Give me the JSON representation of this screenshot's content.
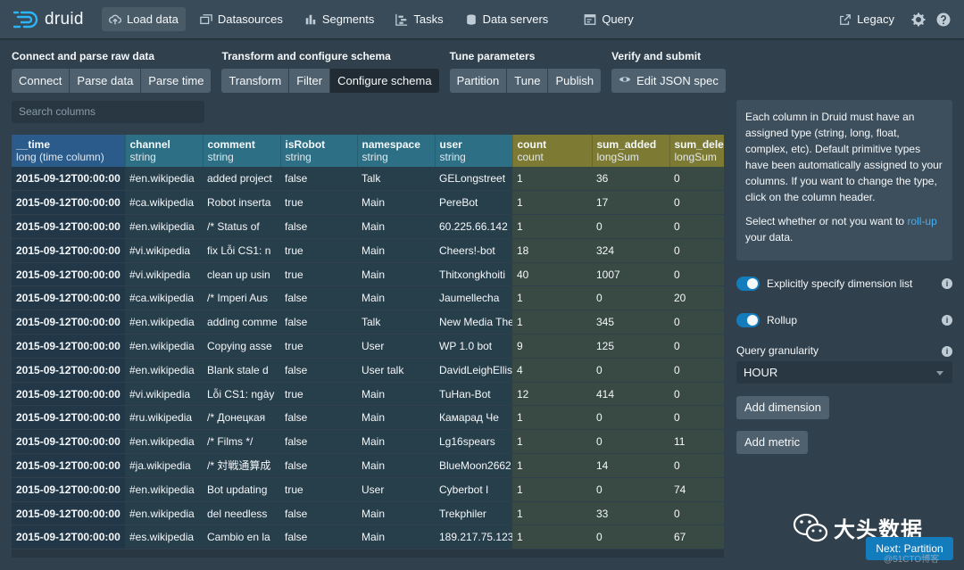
{
  "app": {
    "name": "druid"
  },
  "nav": {
    "items": [
      {
        "label": "Load data",
        "icon": "cloud-upload-icon",
        "active": true
      },
      {
        "label": "Datasources",
        "icon": "multi-select-icon",
        "active": false
      },
      {
        "label": "Segments",
        "icon": "stacked-chart-icon",
        "active": false
      },
      {
        "label": "Tasks",
        "icon": "gantt-chart-icon",
        "active": false
      },
      {
        "label": "Data servers",
        "icon": "database-icon",
        "active": false
      },
      {
        "label": "Query",
        "icon": "application-icon",
        "active": false
      }
    ],
    "legacy": "Legacy"
  },
  "steps": [
    {
      "title": "Connect and parse raw data",
      "buttons": [
        "Connect",
        "Parse data",
        "Parse time"
      ]
    },
    {
      "title": "Transform and configure schema",
      "buttons": [
        "Transform",
        "Filter",
        "Configure schema"
      ]
    },
    {
      "title": "Tune parameters",
      "buttons": [
        "Partition",
        "Tune",
        "Publish"
      ]
    },
    {
      "title": "Verify and submit",
      "buttons": [
        "Edit JSON spec"
      ]
    }
  ],
  "active_step": "Configure schema",
  "search": {
    "placeholder": "Search columns"
  },
  "table": {
    "columns": [
      {
        "name": "__time",
        "type": "long (time column)",
        "kind": "time"
      },
      {
        "name": "channel",
        "type": "string",
        "kind": "dim"
      },
      {
        "name": "comment",
        "type": "string",
        "kind": "dim"
      },
      {
        "name": "isRobot",
        "type": "string",
        "kind": "dim"
      },
      {
        "name": "namespace",
        "type": "string",
        "kind": "dim"
      },
      {
        "name": "user",
        "type": "string",
        "kind": "dim"
      },
      {
        "name": "count",
        "type": "count",
        "kind": "met"
      },
      {
        "name": "sum_added",
        "type": "longSum",
        "kind": "met"
      },
      {
        "name": "sum_deleted",
        "type": "longSum",
        "kind": "met"
      }
    ],
    "rows": [
      [
        "2015-09-12T00:00:00",
        "#en.wikipedia",
        "added project",
        "false",
        "Talk",
        "GELongstreet",
        "1",
        "36",
        "0"
      ],
      [
        "2015-09-12T00:00:00",
        "#ca.wikipedia",
        "Robot inserta",
        "true",
        "Main",
        "PereBot",
        "1",
        "17",
        "0"
      ],
      [
        "2015-09-12T00:00:00",
        "#en.wikipedia",
        "/* Status of ",
        "false",
        "Main",
        "60.225.66.142",
        "1",
        "0",
        "0"
      ],
      [
        "2015-09-12T00:00:00",
        "#vi.wikipedia",
        "fix Lỗi CS1: n",
        "true",
        "Main",
        "Cheers!-bot",
        "18",
        "324",
        "0"
      ],
      [
        "2015-09-12T00:00:00",
        "#vi.wikipedia",
        "clean up usin",
        "true",
        "Main",
        "Thitxongkhoiti",
        "40",
        "1007",
        "0"
      ],
      [
        "2015-09-12T00:00:00",
        "#ca.wikipedia",
        "/* Imperi Aus",
        "false",
        "Main",
        "Jaumellecha",
        "1",
        "0",
        "20"
      ],
      [
        "2015-09-12T00:00:00",
        "#en.wikipedia",
        "adding comme",
        "false",
        "Talk",
        "New Media The",
        "1",
        "345",
        "0"
      ],
      [
        "2015-09-12T00:00:00",
        "#en.wikipedia",
        "Copying asse",
        "true",
        "User",
        "WP 1.0 bot",
        "9",
        "125",
        "0"
      ],
      [
        "2015-09-12T00:00:00",
        "#en.wikipedia",
        "Blank stale d",
        "false",
        "User talk",
        "DavidLeighEllis",
        "4",
        "0",
        "0"
      ],
      [
        "2015-09-12T00:00:00",
        "#vi.wikipedia",
        "Lỗi CS1: ngày",
        "true",
        "Main",
        "TuHan-Bot",
        "12",
        "414",
        "0"
      ],
      [
        "2015-09-12T00:00:00",
        "#ru.wikipedia",
        "/* Донецкая ",
        "false",
        "Main",
        "Камарад Че",
        "1",
        "0",
        "0"
      ],
      [
        "2015-09-12T00:00:00",
        "#en.wikipedia",
        "/* Films */",
        "false",
        "Main",
        "Lg16spears",
        "1",
        "0",
        "11"
      ],
      [
        "2015-09-12T00:00:00",
        "#ja.wikipedia",
        "/* 対戦通算成",
        "false",
        "Main",
        "BlueMoon2662",
        "1",
        "14",
        "0"
      ],
      [
        "2015-09-12T00:00:00",
        "#en.wikipedia",
        "Bot updating ",
        "true",
        "User",
        "Cyberbot I",
        "1",
        "0",
        "74"
      ],
      [
        "2015-09-12T00:00:00",
        "#en.wikipedia",
        "del needless ",
        "false",
        "Main",
        "Trekphiler",
        "1",
        "33",
        "0"
      ],
      [
        "2015-09-12T00:00:00",
        "#es.wikipedia",
        "Cambio en la ",
        "false",
        "Main",
        "189.217.75.123",
        "1",
        "0",
        "67"
      ]
    ]
  },
  "panel": {
    "callout_p1": "Each column in Druid must have an assigned type (string, long, float, complex, etc). Default primitive types have been automatically assigned to your columns. If you want to change the type, click on the column header.",
    "callout_p2_before": "Select whether or not you want to ",
    "callout_p2_link": "roll-up",
    "callout_p2_after": " your data.",
    "explicit_dims_label": "Explicitly specify dimension list",
    "rollup_label": "Rollup",
    "granularity_label": "Query granularity",
    "granularity_value": "HOUR",
    "add_dimension": "Add dimension",
    "add_metric": "Add metric"
  },
  "next_button": "Next: Partition",
  "watermark": {
    "text": "大头数据"
  },
  "credit": "@51CTO博客",
  "colors": {
    "accent": "#137cbd",
    "time_header": "#2b5b8a",
    "dim_header": "#2d7086",
    "metric_header": "#7d7a34",
    "background": "#30404d"
  }
}
